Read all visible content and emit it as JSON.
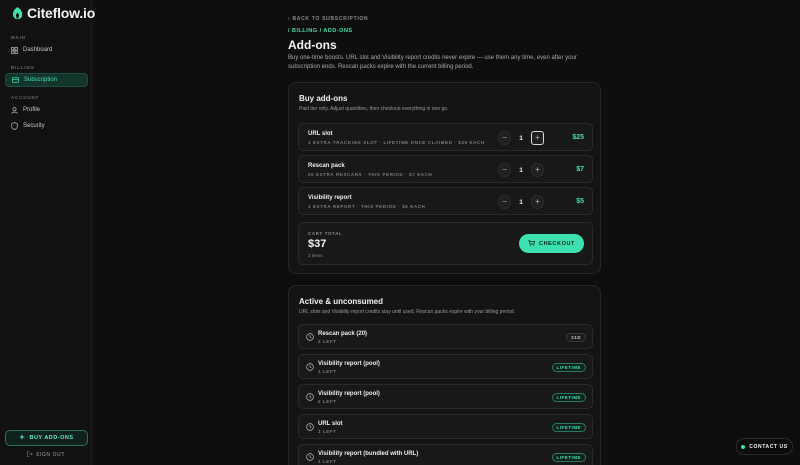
{
  "brand": {
    "name": "Citeflow.io"
  },
  "sidebar": {
    "sections": [
      {
        "label": "MAIN",
        "items": [
          {
            "label": "Dashboard",
            "icon": "grid-icon",
            "active": false
          }
        ]
      },
      {
        "label": "BILLING",
        "items": [
          {
            "label": "Subscription",
            "icon": "card-icon",
            "active": true
          }
        ]
      },
      {
        "label": "ACCOUNT",
        "items": [
          {
            "label": "Profile",
            "icon": "user-icon",
            "active": false
          },
          {
            "label": "Security",
            "icon": "shield-icon",
            "active": false
          }
        ]
      }
    ],
    "buy_addons_label": "BUY ADD-ONS",
    "sign_out_label": "SIGN OUT"
  },
  "header": {
    "back_label": "BACK TO SUBSCRIPTION",
    "breadcrumb": "/ BILLING / ADD-ONS",
    "title": "Add-ons",
    "description": "Buy one-time boosts. URL slot and Visibility report credits never expire — use them any time, even after your subscription ends. Rescan packs expire with the current billing period."
  },
  "buy": {
    "title": "Buy add-ons",
    "subtitle": "Paid tier only. Adjust quantities, then checkout everything in one go.",
    "items": [
      {
        "name": "URL slot",
        "meta": "1 EXTRA TRACKING SLOT · LIFETIME ONCE CLAIMED · $25 EACH",
        "qty": "1",
        "price": "$25"
      },
      {
        "name": "Rescan pack",
        "meta": "20 EXTRA RESCANS · THIS PERIOD · $7 EACH",
        "qty": "1",
        "price": "$7"
      },
      {
        "name": "Visibility report",
        "meta": "1 EXTRA REPORT · THIS PERIOD · $5 EACH",
        "qty": "1",
        "price": "$5"
      }
    ],
    "cart": {
      "label": "CART TOTAL",
      "total": "$37",
      "items": "3 items",
      "checkout_label": "CHECKOUT"
    }
  },
  "active": {
    "title": "Active & unconsumed",
    "subtitle": "URL slots and Visibility report credits stay until used. Rescan packs expire with your billing period.",
    "items": [
      {
        "name": "Rescan pack (20)",
        "meta": "3 LEFT",
        "badge": "21D",
        "badge_type": "days"
      },
      {
        "name": "Visibility report (pool)",
        "meta": "1 LEFT",
        "badge": "LIFETIME",
        "badge_type": "life"
      },
      {
        "name": "Visibility report (pool)",
        "meta": "2 LEFT",
        "badge": "LIFETIME",
        "badge_type": "life"
      },
      {
        "name": "URL slot",
        "meta": "1 LEFT",
        "badge": "LIFETIME",
        "badge_type": "life"
      },
      {
        "name": "Visibility report (bundled with URL)",
        "meta": "1 LEFT",
        "badge": "LIFETIME",
        "badge_type": "life"
      }
    ]
  },
  "contact_label": "CONTACT US",
  "colors": {
    "accent": "#3ee0b0",
    "background": "#0e0e0e",
    "card": "#141414"
  }
}
